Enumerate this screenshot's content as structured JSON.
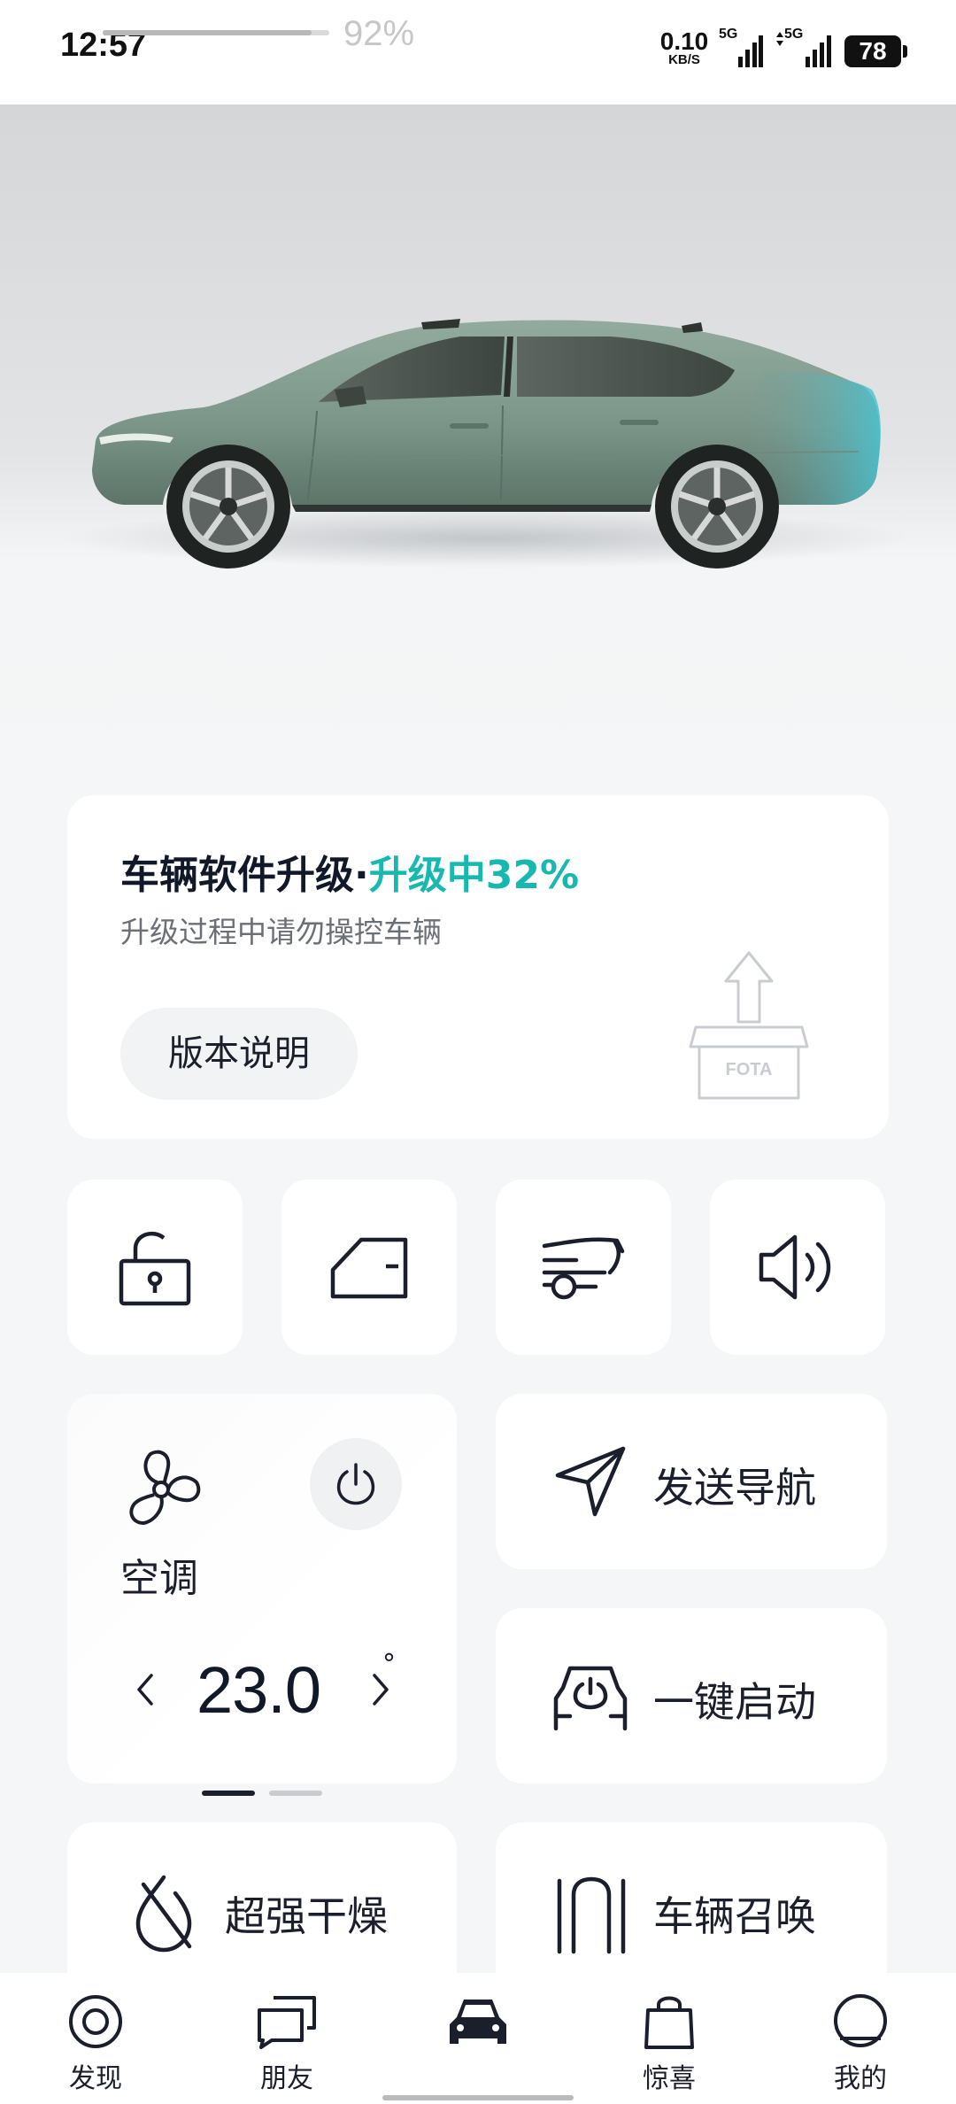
{
  "status_bar": {
    "time": "12:57",
    "download_progress_pct": 92,
    "download_progress_text": "92%",
    "net_speed_value": "0.10",
    "net_speed_unit": "KB/S",
    "sim1_label": "5G",
    "sim2_label": "5G",
    "battery": "78"
  },
  "software_update": {
    "title": "车辆软件升级",
    "separator": "·",
    "status": "升级中32%",
    "progress_pct": 32,
    "subtitle": "升级过程中请勿操控车辆",
    "release_notes_button": "版本说明",
    "illustration_label": "FOTA"
  },
  "quick_controls": [
    {
      "name": "lock",
      "icon": "unlock-padlock-icon"
    },
    {
      "name": "door",
      "icon": "car-door-icon"
    },
    {
      "name": "trunk",
      "icon": "trunk-open-icon"
    },
    {
      "name": "horn",
      "icon": "speaker-icon"
    }
  ],
  "climate": {
    "label": "空调",
    "temperature": "23.0",
    "unit": "°",
    "power_icon": "power-icon",
    "fan_icon": "fan-icon"
  },
  "actions": {
    "send_navigation": "发送导航",
    "one_key_start": "一键启动",
    "super_dry": "超强干燥",
    "vehicle_summon": "车辆召唤"
  },
  "pager": {
    "count": 2,
    "active": 0
  },
  "bottom_nav": [
    {
      "label": "发现",
      "icon": "discover-icon",
      "active": false
    },
    {
      "label": "朋友",
      "icon": "chat-icon",
      "active": false
    },
    {
      "label": "",
      "icon": "car-icon",
      "active": true
    },
    {
      "label": "惊喜",
      "icon": "shopping-bag-icon",
      "active": false
    },
    {
      "label": "我的",
      "icon": "profile-icon",
      "active": false
    }
  ],
  "colors": {
    "accent": "#17b8b0",
    "car_body": "#7f9a8e",
    "text_primary": "#111827",
    "text_secondary": "#6b6f76",
    "background": "#f5f6f7"
  }
}
